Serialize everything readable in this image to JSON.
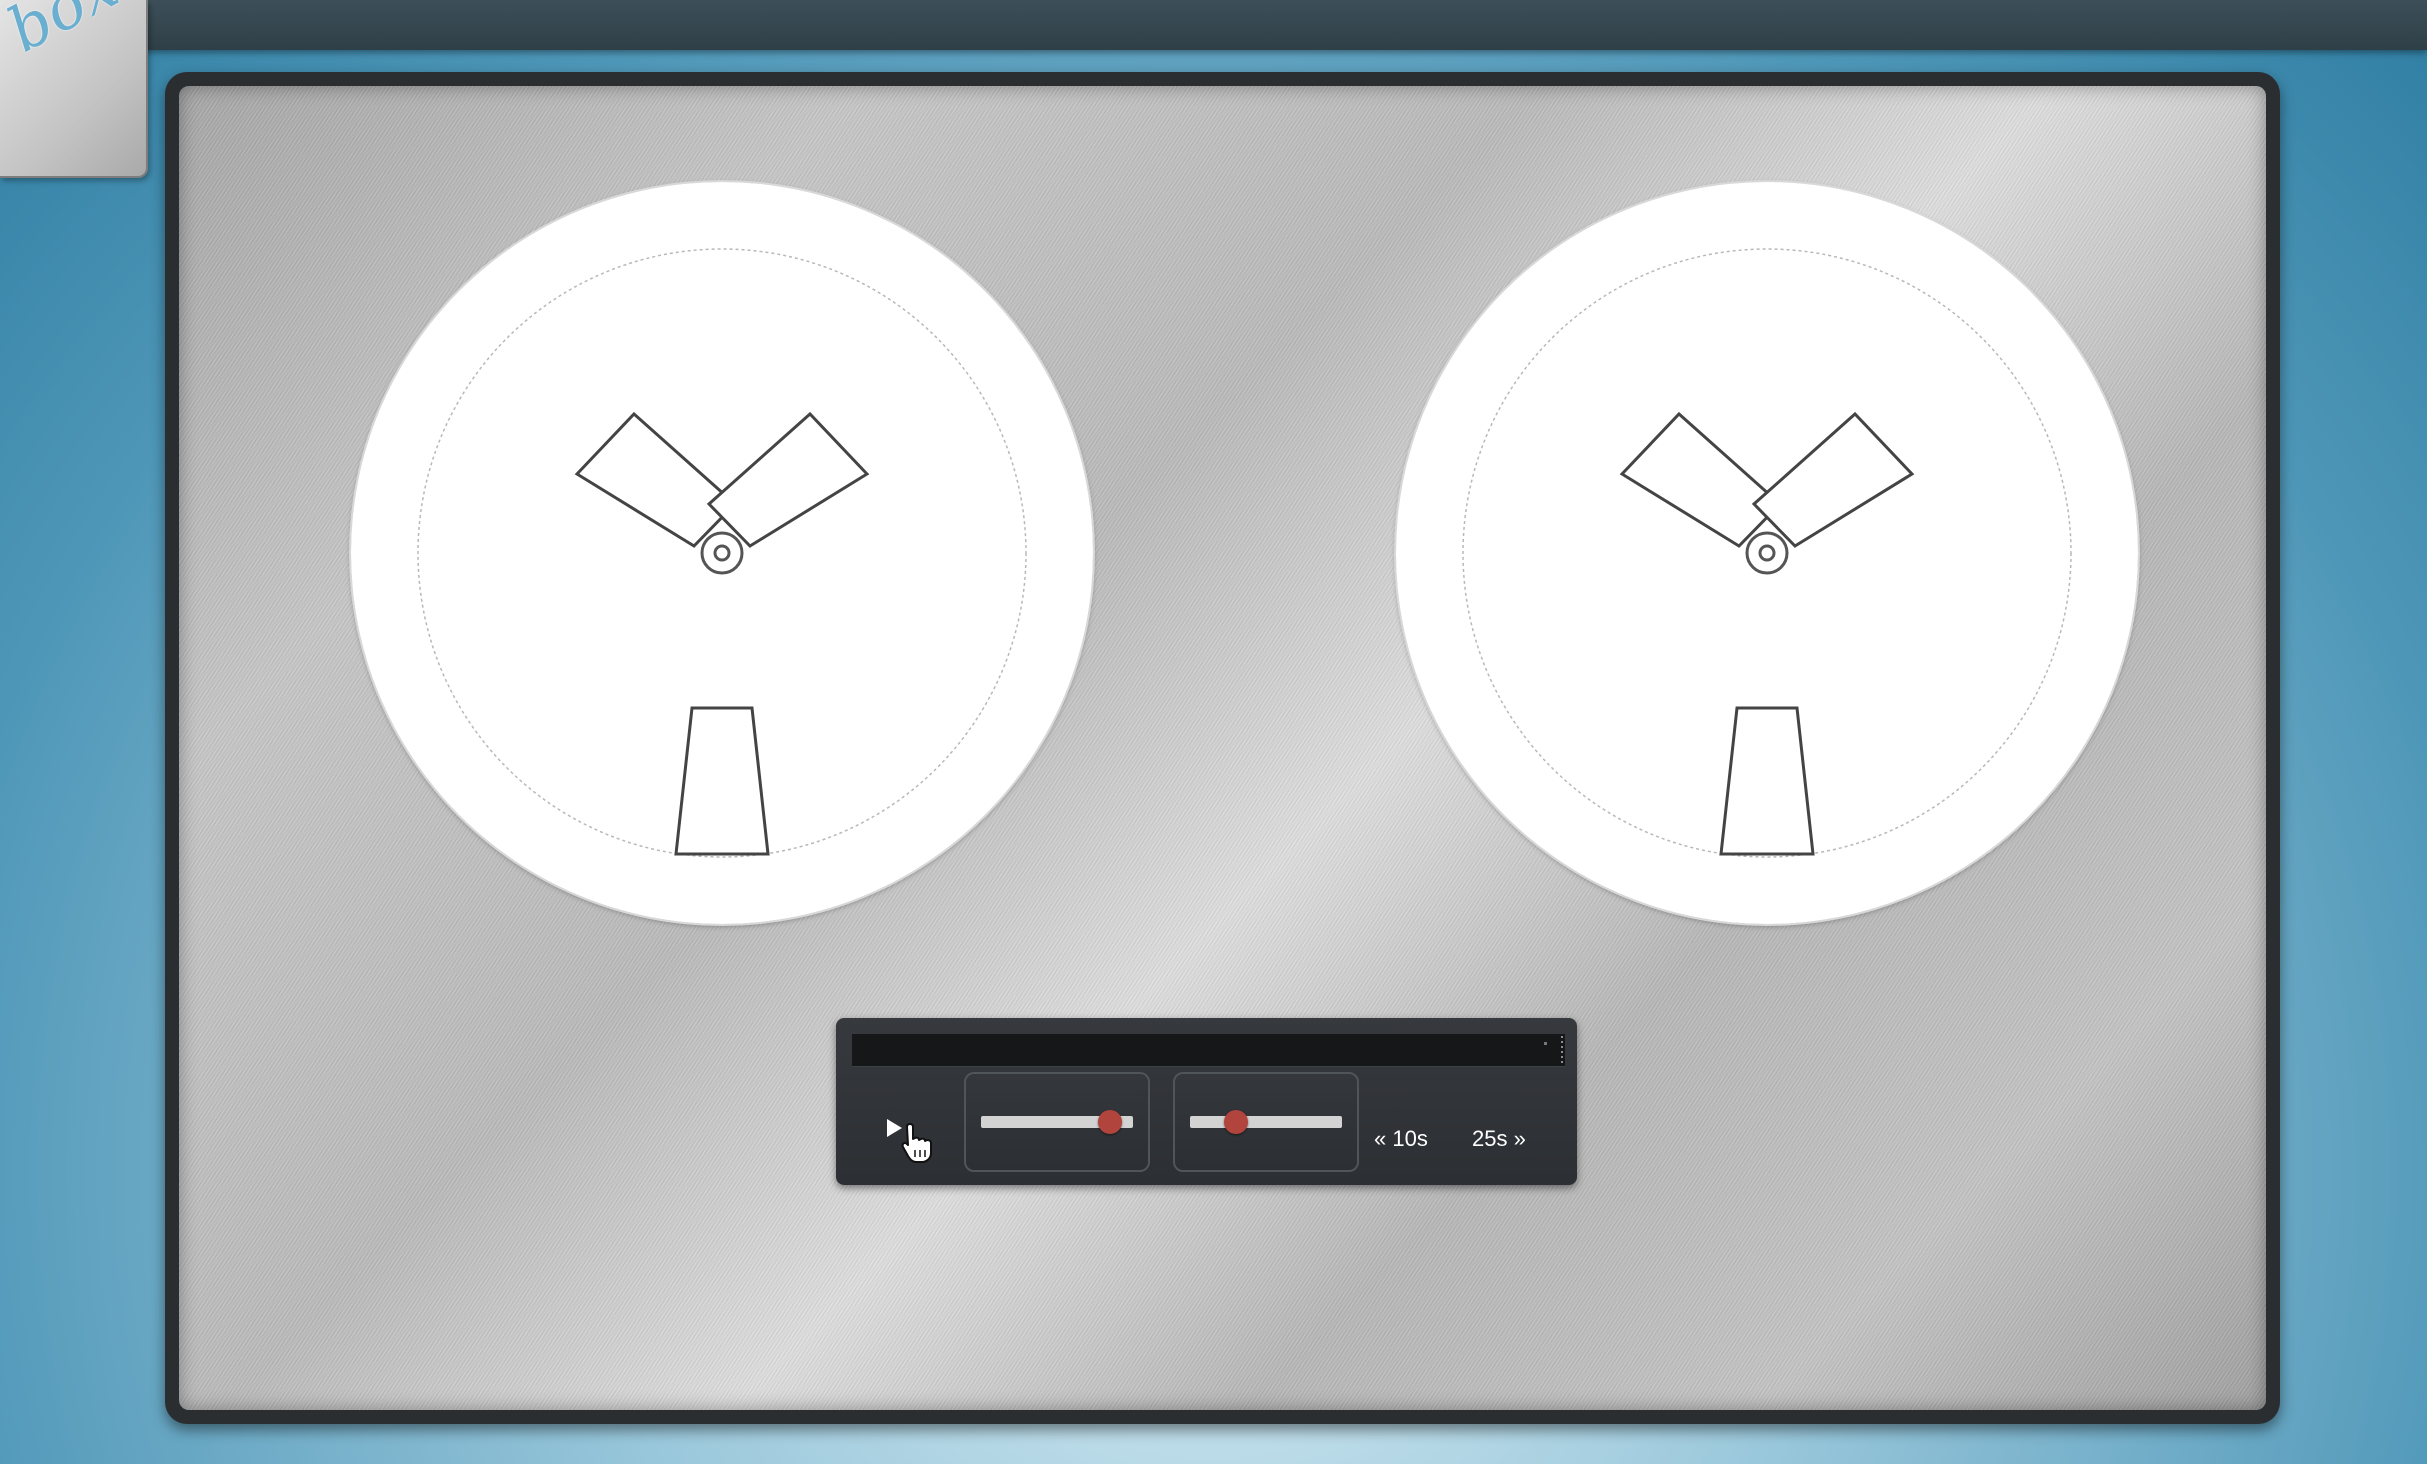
{
  "logo": {
    "text": "box"
  },
  "player": {
    "progress": 1.0,
    "controls": {
      "play_icon": "play-icon",
      "volume_level": 0.85,
      "speed_level": 0.3,
      "skip_back_label": "« 10s",
      "skip_forward_label": "25s »"
    }
  },
  "colors": {
    "slider_thumb": "#b2443e",
    "slider_track": "#d3d3d3",
    "transport_panel": "#2f3236",
    "frame": "#2b2e31",
    "background": "#4f97b8"
  }
}
